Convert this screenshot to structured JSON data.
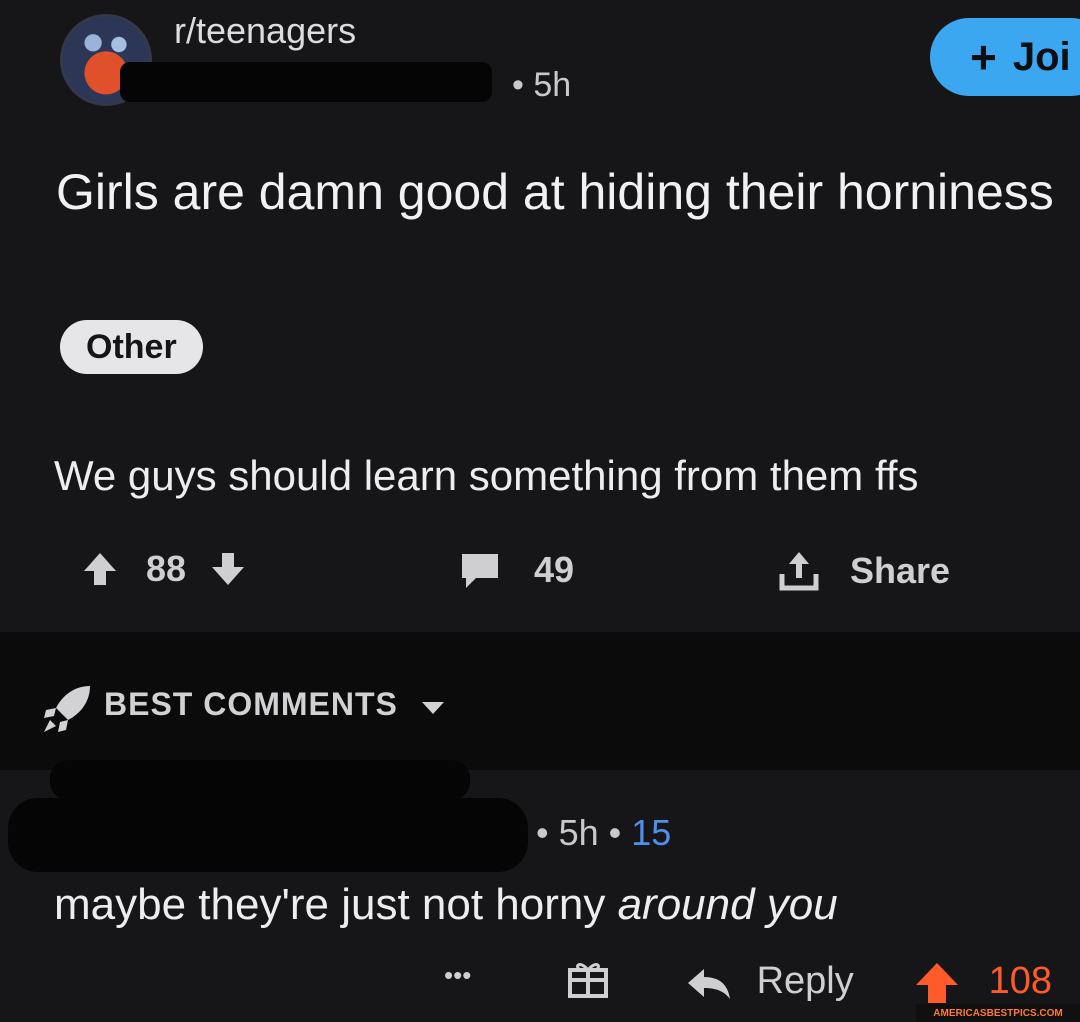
{
  "post": {
    "subreddit": "r/teenagers",
    "time": "• 5h",
    "join_label": "Joi",
    "title": "Girls are damn good at hiding their horniness",
    "flair": "Other",
    "body": "We guys should learn something from them ffs",
    "upvotes": "88",
    "comments": "49",
    "share_label": "Share"
  },
  "sort": {
    "label": "BEST COMMENTS"
  },
  "comment": {
    "time": "• 5h •",
    "score": "15",
    "text_main": "maybe they're just not horny ",
    "text_emphasis": "around you",
    "more_label": "•••",
    "reply_label": "Reply",
    "upvotes": "108"
  },
  "watermark": "AMERICASBESTPICS.COM",
  "colors": {
    "background": "#161618",
    "join_button": "#3ba7f0",
    "upvote_active": "#ff5a2a",
    "score_blue": "#4f8ff0"
  }
}
